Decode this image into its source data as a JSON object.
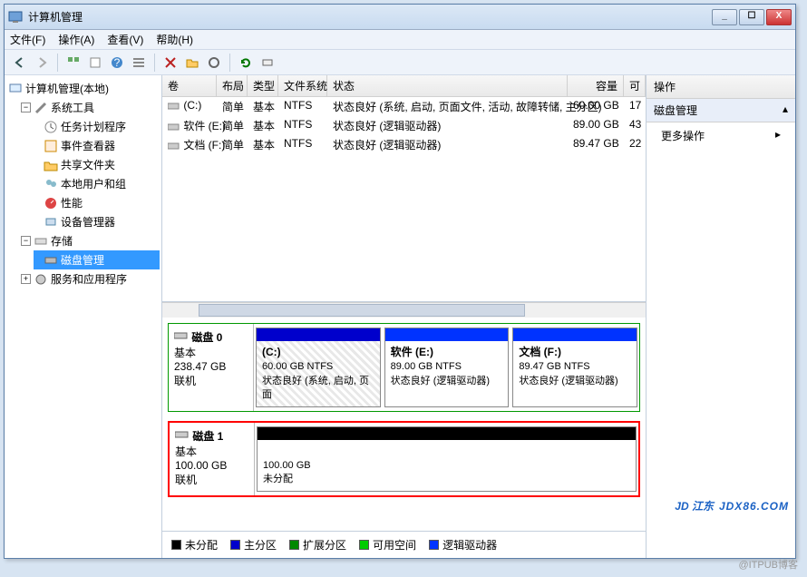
{
  "window": {
    "title": "计算机管理"
  },
  "menubar": [
    {
      "label": "文件(F)"
    },
    {
      "label": "操作(A)"
    },
    {
      "label": "查看(V)"
    },
    {
      "label": "帮助(H)"
    }
  ],
  "tree": {
    "root": "计算机管理(本地)",
    "groups": [
      {
        "label": "系统工具",
        "expanded": true,
        "items": [
          "任务计划程序",
          "事件查看器",
          "共享文件夹",
          "本地用户和组",
          "性能",
          "设备管理器"
        ]
      },
      {
        "label": "存储",
        "expanded": true,
        "items": [
          "磁盘管理"
        ],
        "selected": "磁盘管理"
      },
      {
        "label": "服务和应用程序",
        "expanded": false,
        "items": []
      }
    ]
  },
  "columns": {
    "vol": "卷",
    "layout": "布局",
    "type": "类型",
    "fs": "文件系统",
    "status": "状态",
    "cap": "容量",
    "avail": "可"
  },
  "volumes": [
    {
      "name": "(C:)",
      "layout": "简单",
      "type": "基本",
      "fs": "NTFS",
      "status": "状态良好 (系统, 启动, 页面文件, 活动, 故障转储, 主分区)",
      "cap": "60.00 GB",
      "avail": "17"
    },
    {
      "name": "软件 (E:)",
      "layout": "简单",
      "type": "基本",
      "fs": "NTFS",
      "status": "状态良好 (逻辑驱动器)",
      "cap": "89.00 GB",
      "avail": "43"
    },
    {
      "name": "文档 (F:)",
      "layout": "简单",
      "type": "基本",
      "fs": "NTFS",
      "status": "状态良好 (逻辑驱动器)",
      "cap": "89.47 GB",
      "avail": "22"
    }
  ],
  "disks": [
    {
      "id": "disk0",
      "title": "磁盘 0",
      "type": "基本",
      "size": "238.47 GB",
      "state": "联机",
      "parts": [
        {
          "label": "(C:)",
          "size": "60.00 GB NTFS",
          "status": "状态良好 (系统, 启动, 页面",
          "bar": "pri",
          "hatch": true
        },
        {
          "label": "软件  (E:)",
          "size": "89.00 GB NTFS",
          "status": "状态良好 (逻辑驱动器)",
          "bar": "log"
        },
        {
          "label": "文档  (F:)",
          "size": "89.47 GB NTFS",
          "status": "状态良好 (逻辑驱动器)",
          "bar": "log"
        }
      ]
    },
    {
      "id": "disk1",
      "title": "磁盘 1",
      "type": "基本",
      "size": "100.00 GB",
      "state": "联机",
      "parts": [
        {
          "label": "",
          "size": "100.00 GB",
          "status": "未分配",
          "bar": "un"
        }
      ]
    }
  ],
  "legend": {
    "unalloc": "未分配",
    "primary": "主分区",
    "extended": "扩展分区",
    "free": "可用空间",
    "logical": "逻辑驱动器"
  },
  "actions": {
    "header": "操作",
    "section": "磁盘管理",
    "more": "更多操作"
  },
  "watermark": {
    "brand": "JD 江东",
    "sub": "JDX86.COM"
  },
  "footer": "@ITPUB博客"
}
